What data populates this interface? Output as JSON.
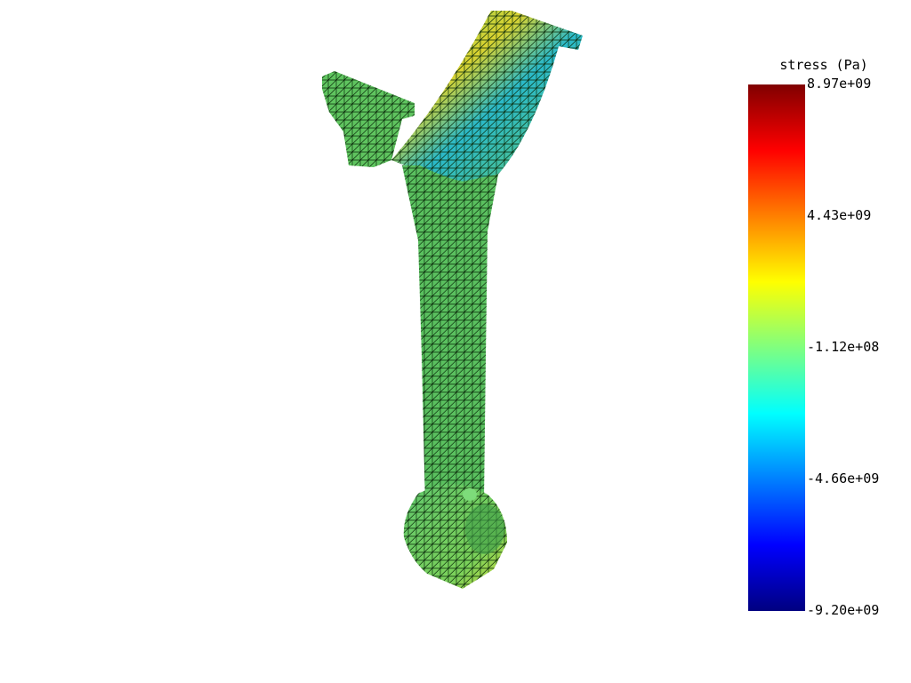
{
  "colorbar": {
    "title": "stress (Pa)",
    "colormap": "jet",
    "ticks": [
      "8.97e+09",
      "4.43e+09",
      "-1.12e+08",
      "-4.66e+09",
      "-9.20e+09"
    ],
    "range": [
      -9200000000.0,
      8970000000.0
    ]
  },
  "model": {
    "mesh_color": "#5fc45f",
    "edge_color": "#000000"
  }
}
